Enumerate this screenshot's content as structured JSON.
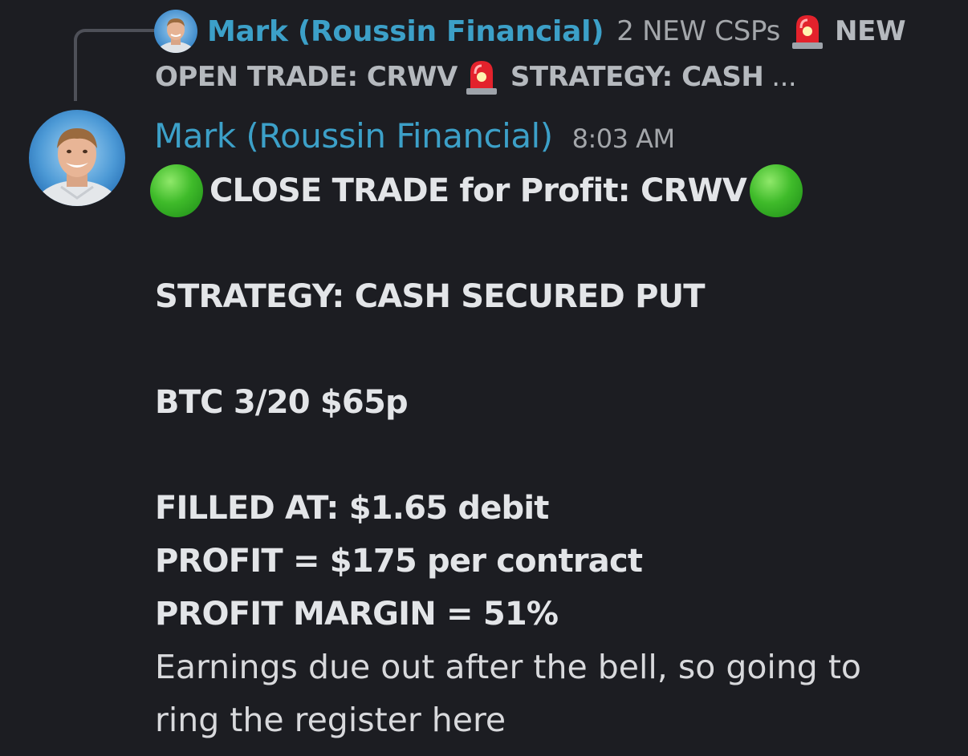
{
  "reply": {
    "author": "Mark (Roussin Financial)",
    "snippet_line1": "2 NEW CSPs",
    "snippet_line1_bold": "NEW",
    "snippet_line2_a": "OPEN TRADE: CRWV",
    "snippet_line2_b": "STRATEGY: CASH",
    "ellipsis": "..."
  },
  "message": {
    "author": "Mark (Roussin Financial)",
    "timestamp": "8:03 AM",
    "title": "CLOSE TRADE for Profit: CRWV",
    "strategy": "STRATEGY: CASH SECURED PUT",
    "order": "BTC 3/20 $65p",
    "filled": "FILLED AT: $1.65 debit",
    "profit": "PROFIT = $175 per contract",
    "margin": "PROFIT MARGIN = 51%",
    "note_line1": "Earnings due out after the bell, so going to",
    "note_line2": "ring the register here"
  },
  "colors": {
    "background": "#1c1d22",
    "author": "#3ca0c8",
    "muted": "#a3a6aa",
    "text": "#e3e5e8"
  },
  "icons": {
    "siren": "rotating-light-emoji",
    "status": "green-circle-emoji"
  }
}
